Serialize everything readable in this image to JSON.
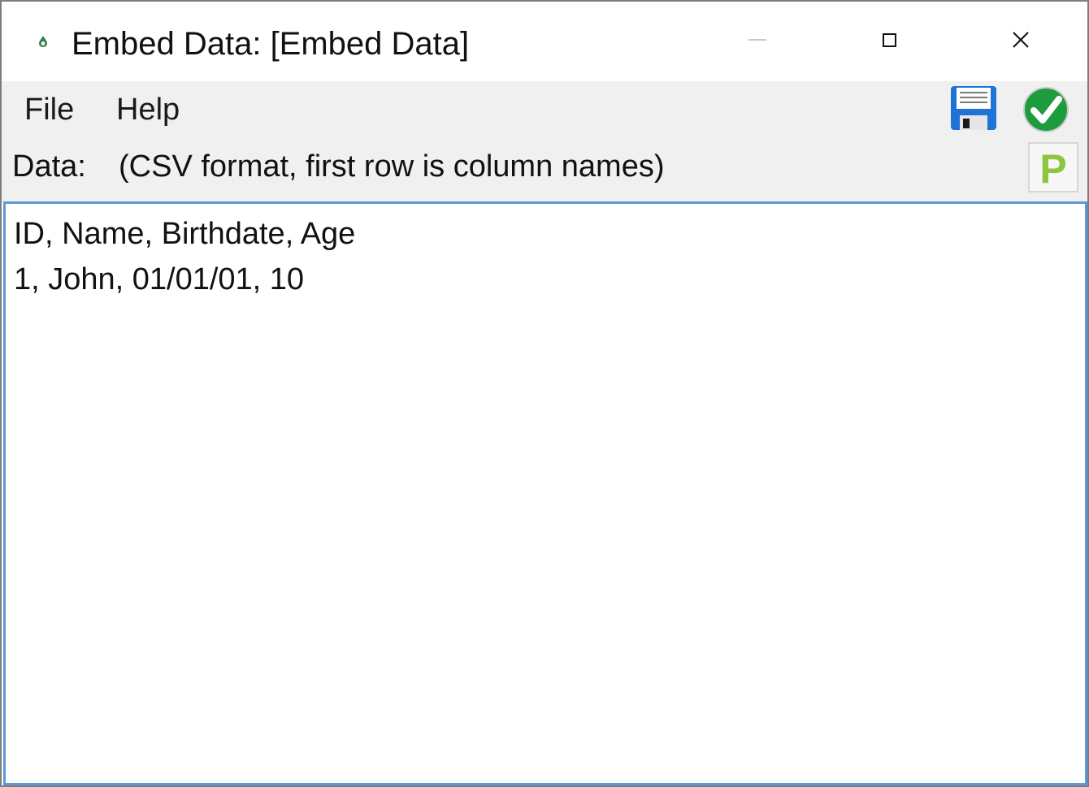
{
  "window": {
    "title": "Embed Data: [Embed Data]",
    "app_icon": "drop-icon",
    "controls": {
      "minimize_icon": "minimize-icon",
      "maximize_icon": "maximize-icon",
      "close_icon": "close-icon"
    }
  },
  "menu": {
    "file_label": "File",
    "help_label": "Help"
  },
  "toolbar": {
    "save_icon": "floppy-disk-icon",
    "apply_icon": "check-circle-icon",
    "p_icon": "p-badge-icon",
    "p_letter": "P"
  },
  "data_section": {
    "label": "Data:",
    "hint": "(CSV format, first row is column names)"
  },
  "editor": {
    "lines": [
      "ID, Name, Birthdate, Age",
      "1, John, 01/01/01, 10"
    ]
  },
  "colors": {
    "accent_border": "#5b9bd5",
    "check_green": "#1e9b3c",
    "floppy_blue": "#1f73d6",
    "p_green": "#8dc63f"
  }
}
